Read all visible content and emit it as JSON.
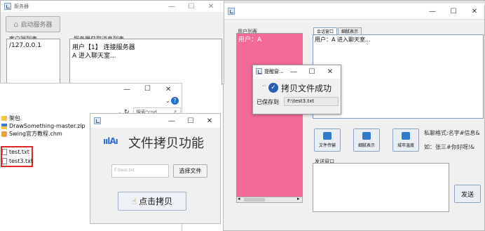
{
  "server_window": {
    "title": "服务器",
    "start_button": "启动服务器",
    "client_list_label": "客户端列表",
    "client_entry": "/127.0.0.1",
    "messages_label": "服务器获取消息列表",
    "messages": [
      "用户【1】 连接服务器",
      "A 进入聊天室..."
    ]
  },
  "explorer_window": {
    "search_placeholder": "搜索\"cod...",
    "files": [
      {
        "name": "架包",
        "icon": "folder-icon",
        "type": "folder"
      },
      {
        "name": "DrawSomething-master.zip",
        "icon": "zip-icon",
        "type": "zip"
      },
      {
        "name": "Swing官方教程.chm",
        "icon": "chm-icon",
        "type": "chm"
      },
      {
        "name": "test.txt",
        "icon": "txt-icon",
        "type": "txt",
        "highlighted": true
      },
      {
        "name": "test3.txt",
        "icon": "txt-icon",
        "type": "txt",
        "highlighted": true
      }
    ],
    "highlight_color": "#e0252b"
  },
  "copy_window": {
    "title": "文件拷贝功能",
    "path_placeholder": "F:\\test.txt",
    "choose_button": "选择文件",
    "copy_button": "点击拷贝"
  },
  "chat_window": {
    "tab_chat": "会话窗口",
    "tab_detail": "细腻表示",
    "user_list_label": "用户列表",
    "user_list_item": "用户：A",
    "chat_content": "用户：A 进入聊天室...",
    "tool_buttons": [
      "文件传输",
      "细腻表示",
      "城市温度"
    ],
    "hint_line1": "私聊格式:名字#信息&",
    "hint_line2": "如：张三#你好呀!&",
    "send_label": "发送窗口",
    "send_button": "发送",
    "user_list_color": "#f3699a"
  },
  "dialog": {
    "title": "提醒窗...",
    "message": "拷贝文件成功",
    "saved_label": "已保存到",
    "saved_path": "F:\\test3.txt"
  },
  "window_controls": {
    "minimize": "—",
    "maximize": "☐",
    "close": "✕"
  }
}
